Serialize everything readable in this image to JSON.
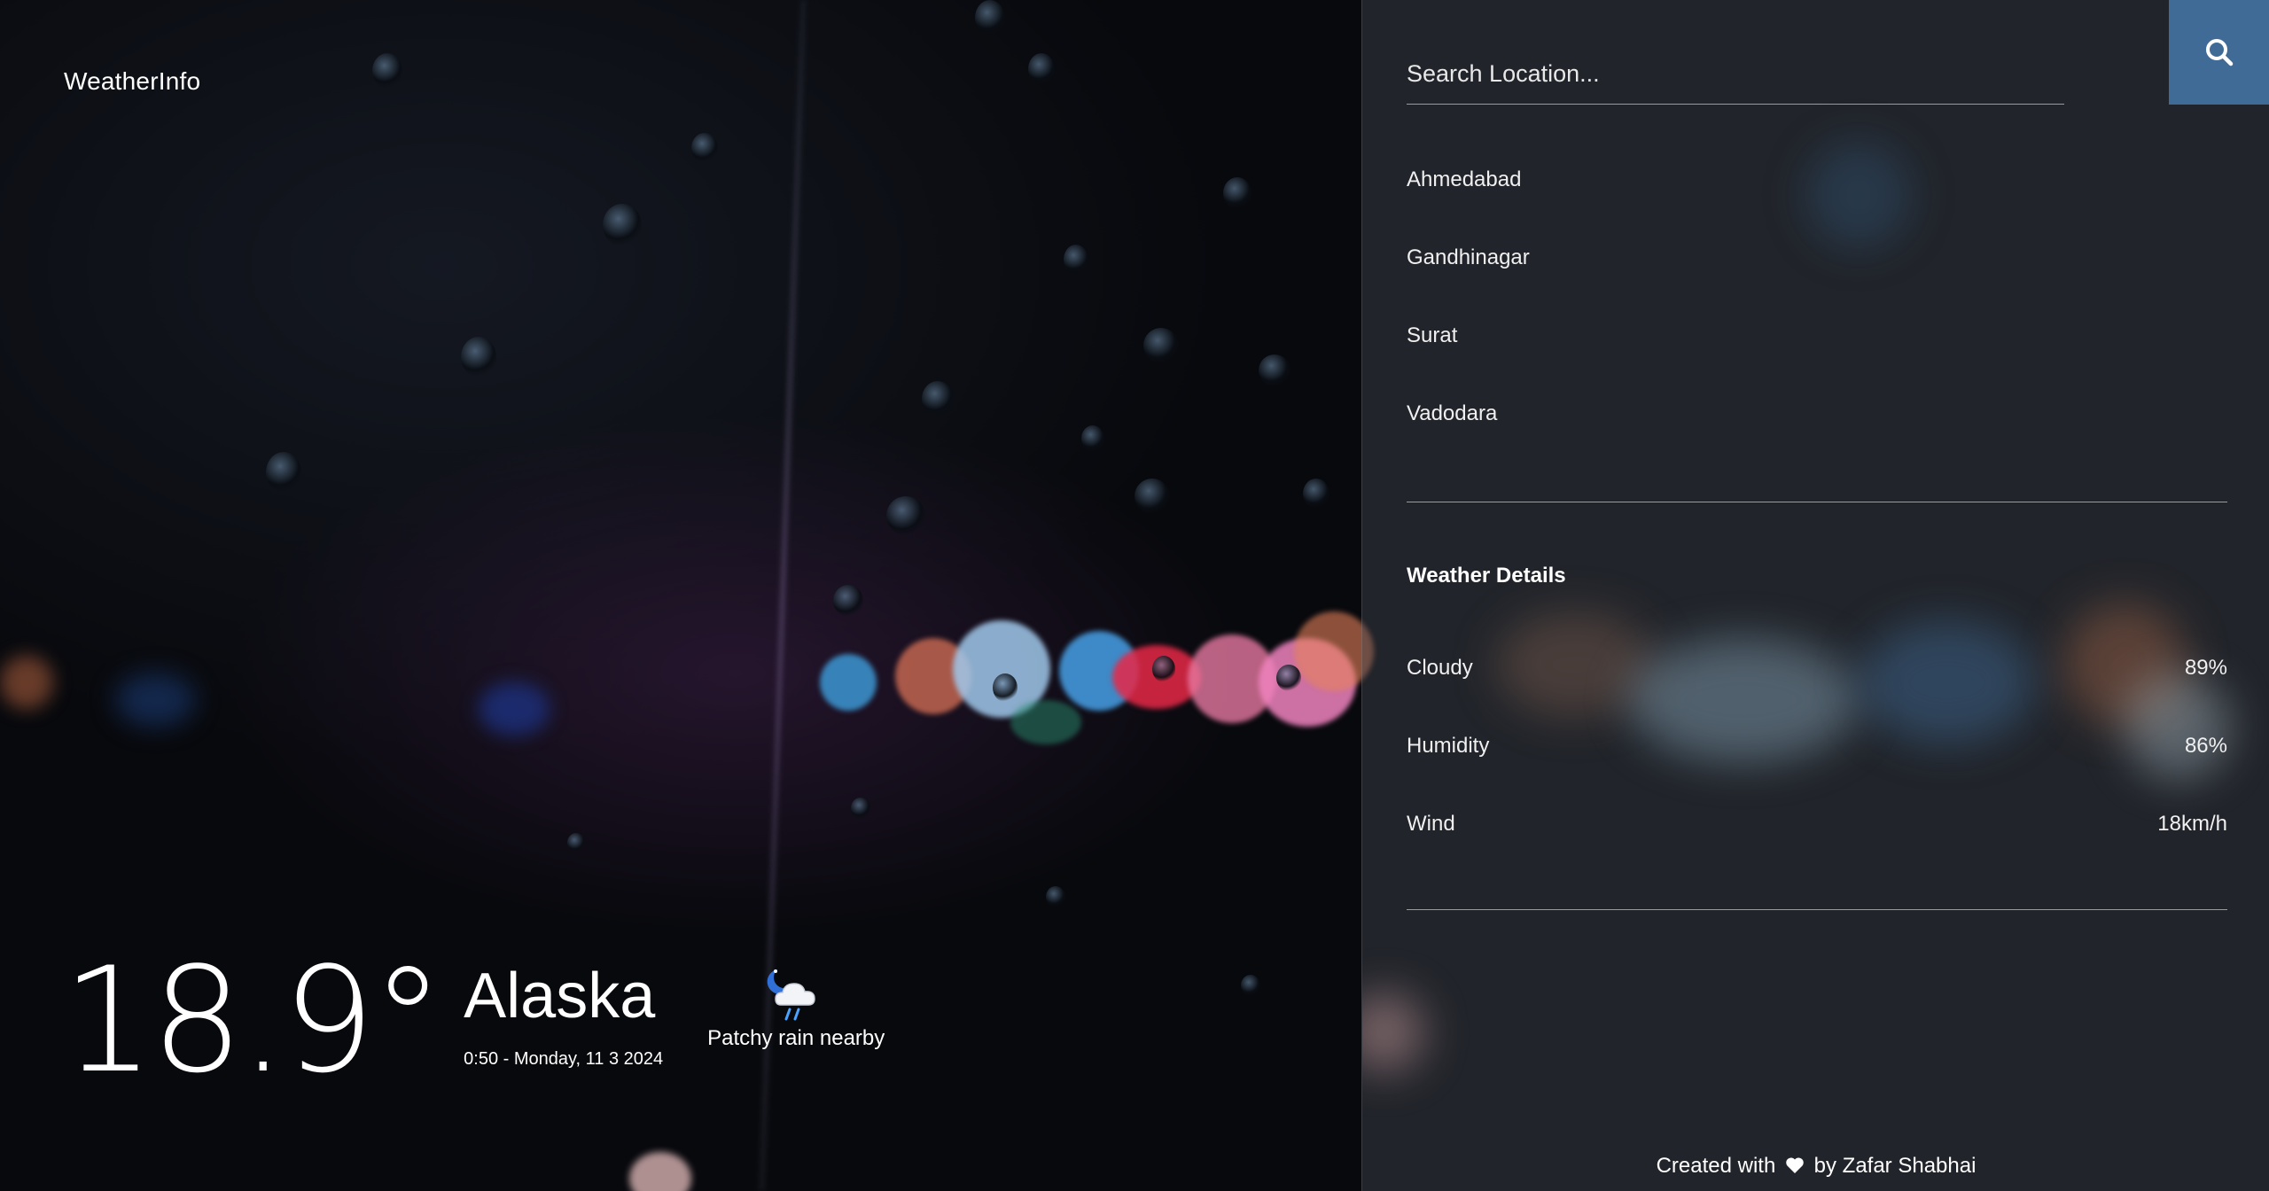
{
  "brand": {
    "name": "WeatherInfo"
  },
  "current": {
    "temperature": "18.9°",
    "location": "Alaska",
    "datetime": "0:50 - Monday, 11 3 2024",
    "condition": "Patchy rain nearby",
    "condition_icon": "night-cloud-rain-icon"
  },
  "search": {
    "placeholder": "Search Location...",
    "value": "",
    "button_icon": "search-icon",
    "accent_color": "#3f6b96"
  },
  "locations": [
    "Ahmedabad",
    "Gandhinagar",
    "Surat",
    "Vadodara"
  ],
  "details": {
    "title": "Weather Details",
    "rows": [
      {
        "label": "Cloudy",
        "value": "89%"
      },
      {
        "label": "Humidity",
        "value": "86%"
      },
      {
        "label": "Wind",
        "value": "18km/h"
      }
    ]
  },
  "footer": {
    "prefix": "Created with",
    "icon": "heart-icon",
    "suffix": "by Zafar Shabhai"
  }
}
